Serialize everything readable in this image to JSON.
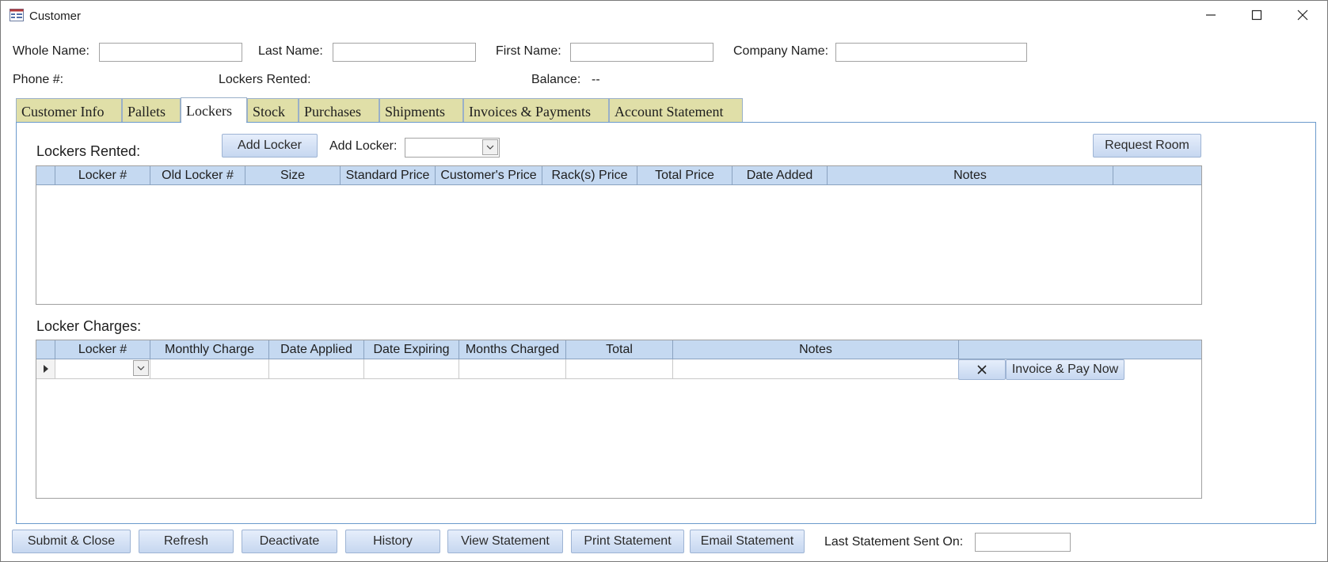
{
  "window": {
    "title": "Customer"
  },
  "header": {
    "whole_name_label": "Whole Name:",
    "last_name_label": "Last Name:",
    "first_name_label": "First Name:",
    "company_name_label": "Company Name:",
    "phone_label": "Phone #:",
    "lockers_rented_label": "Lockers Rented:",
    "balance_label": "Balance:",
    "balance_value": "--",
    "whole_name_value": "",
    "last_name_value": "",
    "first_name_value": "",
    "company_name_value": ""
  },
  "tabs": [
    {
      "label": "Customer Info"
    },
    {
      "label": "Pallets"
    },
    {
      "label": "Lockers",
      "active": true
    },
    {
      "label": "Stock"
    },
    {
      "label": "Purchases"
    },
    {
      "label": "Shipments"
    },
    {
      "label": "Invoices & Payments"
    },
    {
      "label": "Account Statement"
    }
  ],
  "lockers": {
    "section_label": "Lockers Rented:",
    "add_locker_button": "Add Locker",
    "add_locker_label": "Add Locker:",
    "request_room_button": "Request Room",
    "columns": [
      "Locker #",
      "Old Locker #",
      "Size",
      "Standard Price",
      "Customer's Price",
      "Rack(s) Price",
      "Total Price",
      "Date Added",
      "Notes"
    ]
  },
  "charges": {
    "section_label": "Locker Charges:",
    "columns": [
      "Locker #",
      "Monthly Charge",
      "Date Applied",
      "Date Expiring",
      "Months Charged",
      "Total",
      "Notes"
    ],
    "invoice_button": "Invoice & Pay Now"
  },
  "footer": {
    "submit_close": "Submit & Close",
    "refresh": "Refresh",
    "deactivate": "Deactivate",
    "history": "History",
    "view_statement": "View Statement",
    "print_statement": "Print Statement",
    "email_statement": "Email Statement",
    "last_statement_label": "Last Statement Sent On:",
    "last_statement_value": ""
  },
  "icons": {
    "app": "form-icon",
    "minimize": "minimize-icon",
    "maximize": "maximize-icon",
    "close": "close-icon",
    "dropdown": "chevron-down-icon",
    "record_selector": "record-pointer-icon",
    "delete": "delete-x-icon"
  },
  "colors": {
    "tab_inactive": "#e0dfa8",
    "grid_header": "#c5d9f1",
    "panel_border": "#6b9acc",
    "button_top": "#e6eefb",
    "button_bottom": "#c6d7f0"
  }
}
